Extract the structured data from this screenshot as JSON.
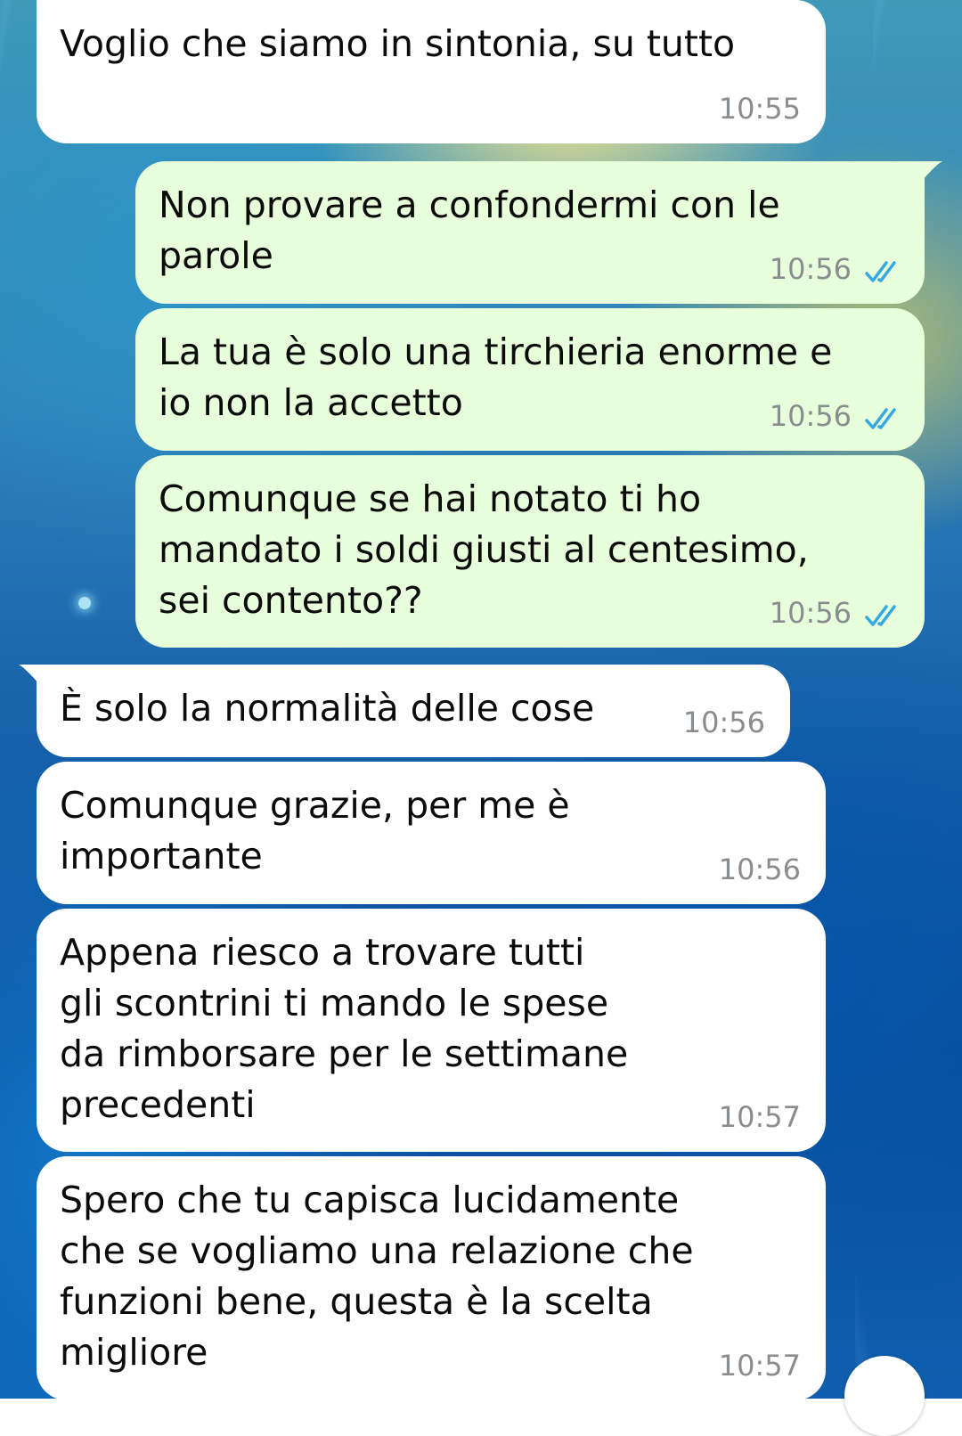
{
  "chat": {
    "messages": [
      {
        "direction": "in",
        "text": "Voglio che siamo in sintonia, su tutto",
        "time": "10:55",
        "status": ""
      },
      {
        "direction": "out",
        "text": "Non provare a confondermi con le\nparole",
        "time": "10:56",
        "status": "read"
      },
      {
        "direction": "out",
        "text": "La tua è solo una tirchieria enorme e\nio non la accetto",
        "time": "10:56",
        "status": "read"
      },
      {
        "direction": "out",
        "text": "Comunque se hai notato ti ho\nmandato i soldi giusti al centesimo,\nsei contento??",
        "time": "10:56",
        "status": "read"
      },
      {
        "direction": "in",
        "text": "È solo la normalità delle cose",
        "time": "10:56",
        "status": ""
      },
      {
        "direction": "in",
        "text": "Comunque grazie, per me è\nimportante",
        "time": "10:56",
        "status": ""
      },
      {
        "direction": "in",
        "text": "Appena riesco a trovare tutti\ngli scontrini ti mando le spese\nda rimborsare per le settimane\nprecedenti",
        "time": "10:57",
        "status": ""
      },
      {
        "direction": "in",
        "text": "Spero che tu capisca lucidamente\nche se vogliamo una relazione che\nfunzioni bene, questa è la scelta\nmigliore",
        "time": "10:57",
        "status": ""
      }
    ]
  },
  "colors": {
    "incoming_bubble": "#ffffff",
    "outgoing_bubble": "#e7ffdb",
    "read_ticks": "#34a8e0",
    "timestamp": "#8a8d8f"
  },
  "icons": {
    "read_receipt": "double-check-icon",
    "scroll_button": "scroll-down-button"
  }
}
